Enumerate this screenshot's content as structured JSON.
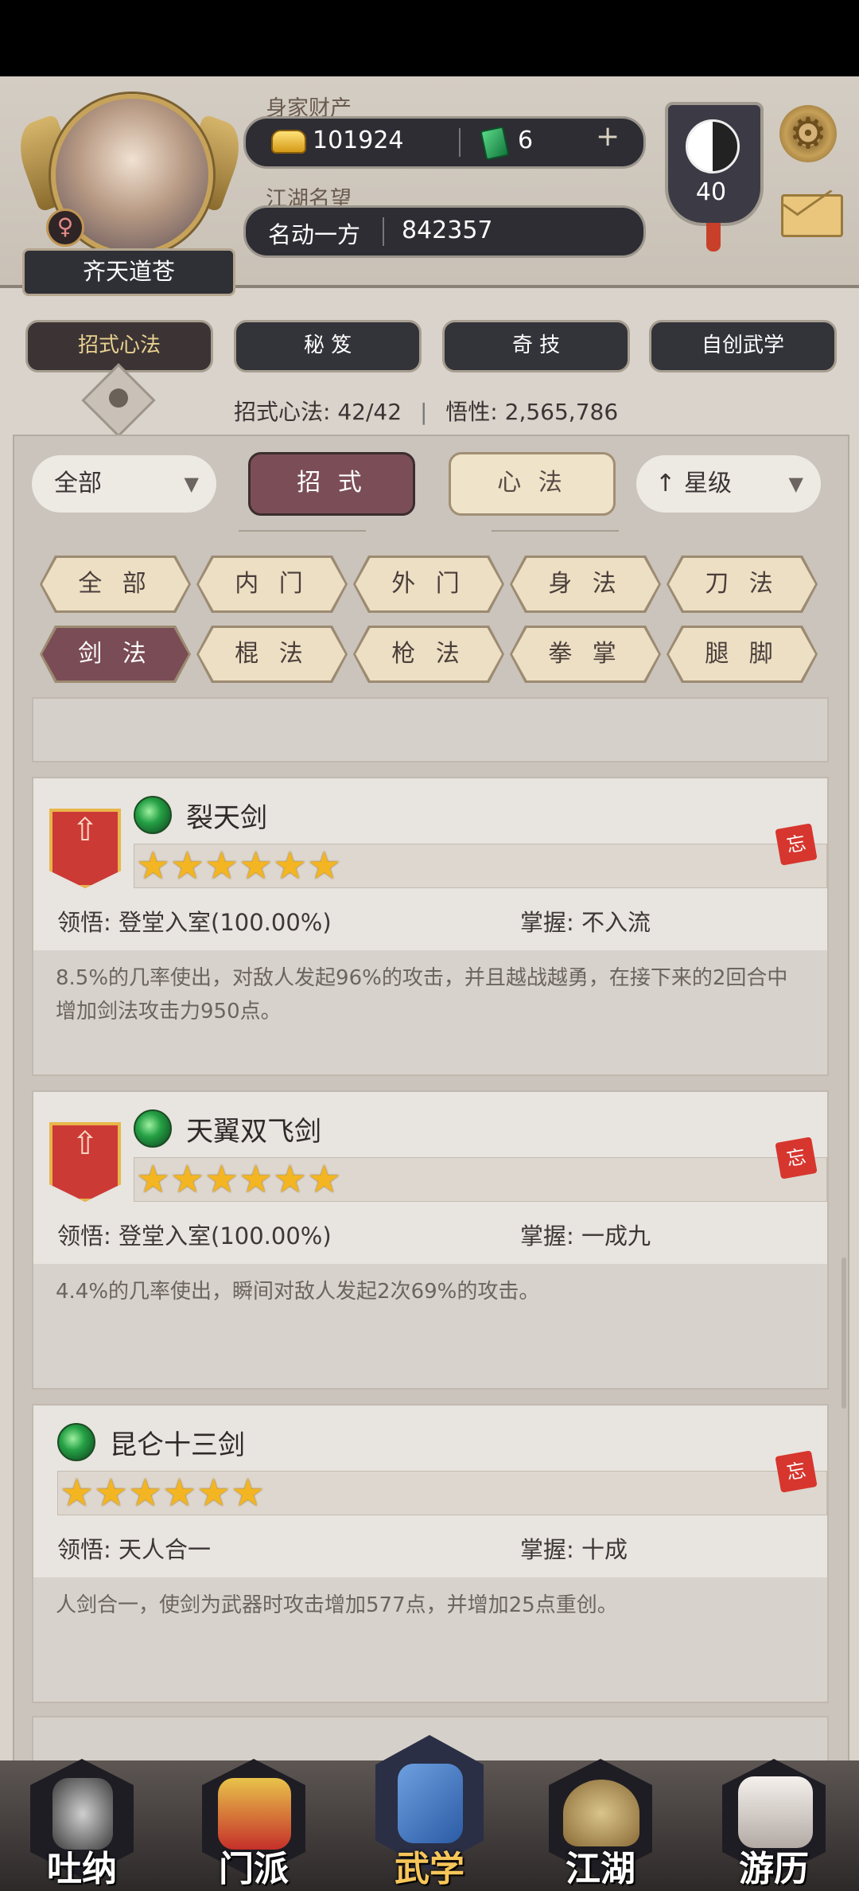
{
  "header": {
    "player_name": "齐天道苍",
    "gender_symbol": "♀",
    "wealth_label": "身家财产",
    "gold": "101924",
    "jade": "6",
    "fame_label": "江湖名望",
    "fame_rank": "名动一方",
    "fame_value": "842357",
    "level": "40",
    "gear_glyph": "⚙"
  },
  "main_tabs": [
    {
      "label": "招式心法",
      "active": true
    },
    {
      "label": "秘 笈",
      "active": false
    },
    {
      "label": "奇 技",
      "active": false
    },
    {
      "label": "自创武学",
      "active": false
    }
  ],
  "summary": {
    "moves_label": "招式心法:",
    "moves_count": "42/42",
    "insight_label": "悟性:",
    "insight_value": "2,565,786"
  },
  "filters": {
    "dropdown_left": "全部",
    "toggle_move": "招 式",
    "toggle_method": "心 法",
    "sort_label": "星级",
    "categories_row1": [
      "全 部",
      "内 门",
      "外 门",
      "身 法",
      "刀 法"
    ],
    "categories_row2": [
      "剑 法",
      "棍 法",
      "枪 法",
      "拳 掌",
      "腿 脚"
    ],
    "active_category": "剑 法"
  },
  "skills": [
    {
      "name": "裂天剑",
      "stars": 6,
      "comprehension_label": "领悟:",
      "comprehension": "登堂入室(100.00%)",
      "mastery_label": "掌握:",
      "mastery": "不入流",
      "desc": "8.5%的几率使出，对敌人发起96%的攻击，并且越战越勇，在接下来的2回合中增加剑法攻击力950点。",
      "forget": "忘"
    },
    {
      "name": "天翼双飞剑",
      "stars": 6,
      "comprehension_label": "领悟:",
      "comprehension": "登堂入室(100.00%)",
      "mastery_label": "掌握:",
      "mastery": "一成九",
      "desc": "4.4%的几率使出，瞬间对敌人发起2次69%的攻击。",
      "forget": "忘"
    },
    {
      "name": "昆仑十三剑",
      "stars": 6,
      "comprehension_label": "领悟:",
      "comprehension": "天人合一",
      "mastery_label": "掌握:",
      "mastery": "十成",
      "desc": "人剑合一，使剑为武器时攻击增加577点，并增加25点重创。",
      "forget": "忘"
    }
  ],
  "bottom_nav": [
    {
      "label": "吐纳",
      "icon": "meditate-icon"
    },
    {
      "label": "门派",
      "icon": "sect-flag-icon"
    },
    {
      "label": "武学",
      "icon": "book-icon",
      "active": true
    },
    {
      "label": "江湖",
      "icon": "straw-hat-icon"
    },
    {
      "label": "游历",
      "icon": "horse-icon"
    }
  ],
  "colors": {
    "accent_active": "#7b4e57",
    "star": "#f3b522",
    "badge_red": "#cc3a36",
    "panel_bg": "#cbc4bc"
  }
}
